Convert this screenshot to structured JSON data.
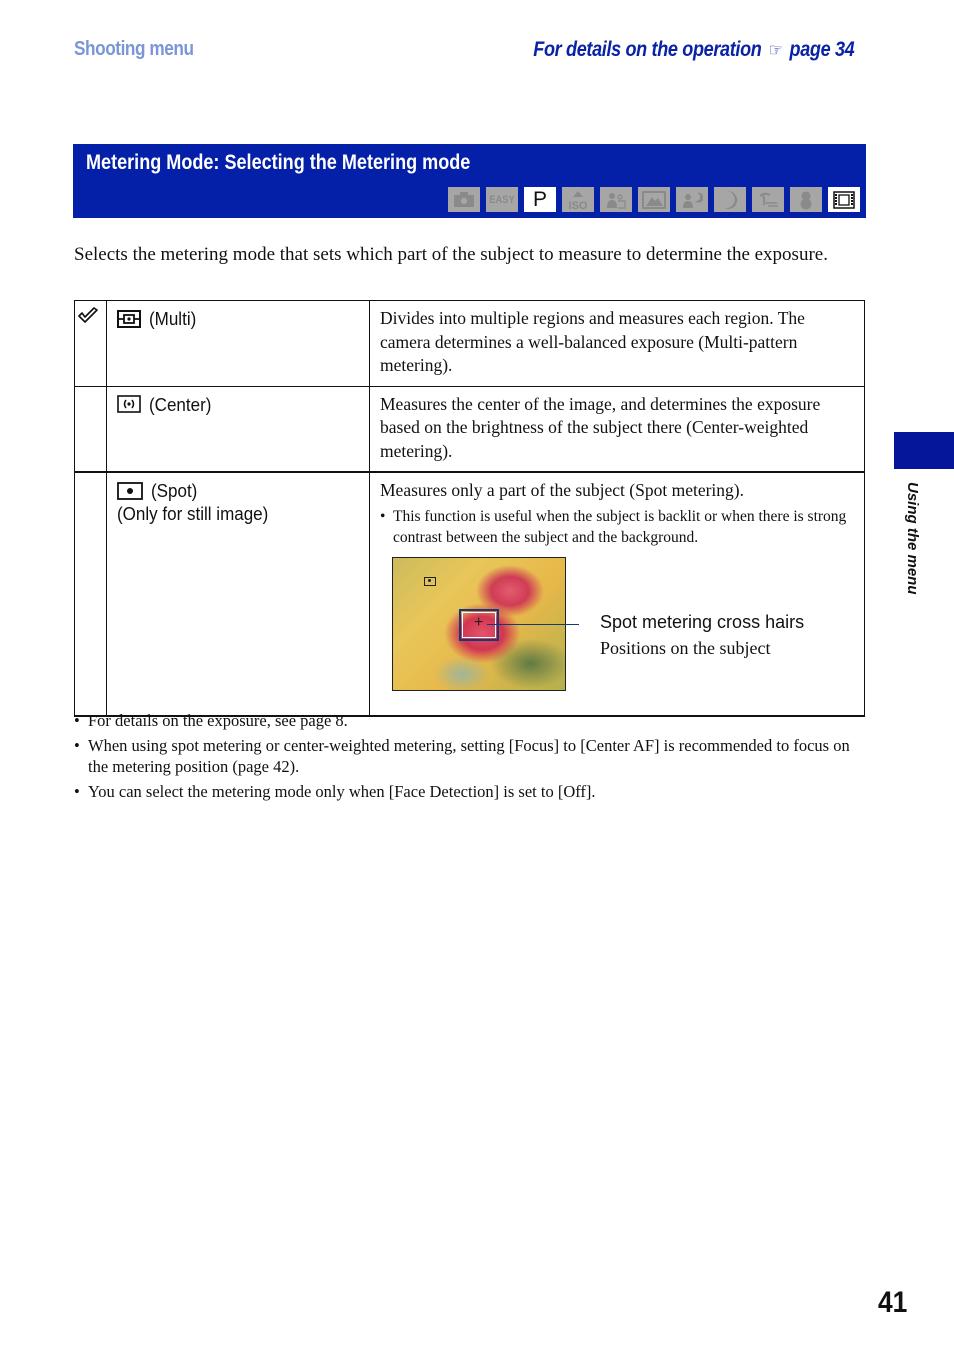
{
  "header": {
    "section": "Shooting menu",
    "details_prefix": "For details on the operation",
    "details_icon": "pointing-hand-icon",
    "details_page": "page 34"
  },
  "title_bar": {
    "title": "Metering Mode: Selecting the Metering mode",
    "mode_icons": [
      {
        "name": "auto-camera",
        "label": "",
        "active": false
      },
      {
        "name": "easy",
        "label": "EASY",
        "active": false
      },
      {
        "name": "program",
        "label": "P",
        "active": true
      },
      {
        "name": "high-sensitivity-iso",
        "label": "ISO",
        "active": false
      },
      {
        "name": "soft-snap",
        "label": "",
        "active": false
      },
      {
        "name": "landscape",
        "label": "",
        "active": false
      },
      {
        "name": "twilight-portrait",
        "label": "",
        "active": false
      },
      {
        "name": "twilight",
        "label": "",
        "active": false
      },
      {
        "name": "beach",
        "label": "",
        "active": false
      },
      {
        "name": "snow",
        "label": "",
        "active": false
      },
      {
        "name": "movie",
        "label": "",
        "active": true
      }
    ]
  },
  "intro": "Selects the metering mode that sets which part of the subject to measure to determine the exposure.",
  "modes": [
    {
      "default": true,
      "icon": "multi-metering-icon",
      "name": "(Multi)",
      "sub": "",
      "description": "Divides into multiple regions and measures each region. The camera determines a well-balanced exposure (Multi-pattern metering)."
    },
    {
      "default": false,
      "icon": "center-metering-icon",
      "name": "(Center)",
      "sub": "",
      "description": "Measures the center of the image, and determines the exposure based on the brightness of the subject there (Center-weighted metering)."
    },
    {
      "default": false,
      "icon": "spot-metering-icon",
      "name": "(Spot)",
      "sub": "(Only for still image)",
      "description": "Measures only a part of the subject (Spot metering).",
      "bullet": "This function is useful when the subject is backlit or when there is strong contrast between the subject and the background.",
      "callout_title": "Spot metering cross hairs",
      "callout_sub": "Positions on the subject"
    }
  ],
  "notes": [
    "For details on the exposure, see page 8.",
    "When using spot metering or center-weighted metering, setting [Focus] to [Center AF] is recommended to focus on the metering position (page 42).",
    "You can select the metering mode only when [Face Detection] is set to [Off]."
  ],
  "side_tab": {
    "label": "Using the menu",
    "color": "#05169a"
  },
  "page_number": "41",
  "colors": {
    "title_bar": "#0520a8",
    "section_header": "#7b96d6",
    "details_link": "#0a22a6",
    "mode_icon_inactive": "#a6a6a6"
  }
}
